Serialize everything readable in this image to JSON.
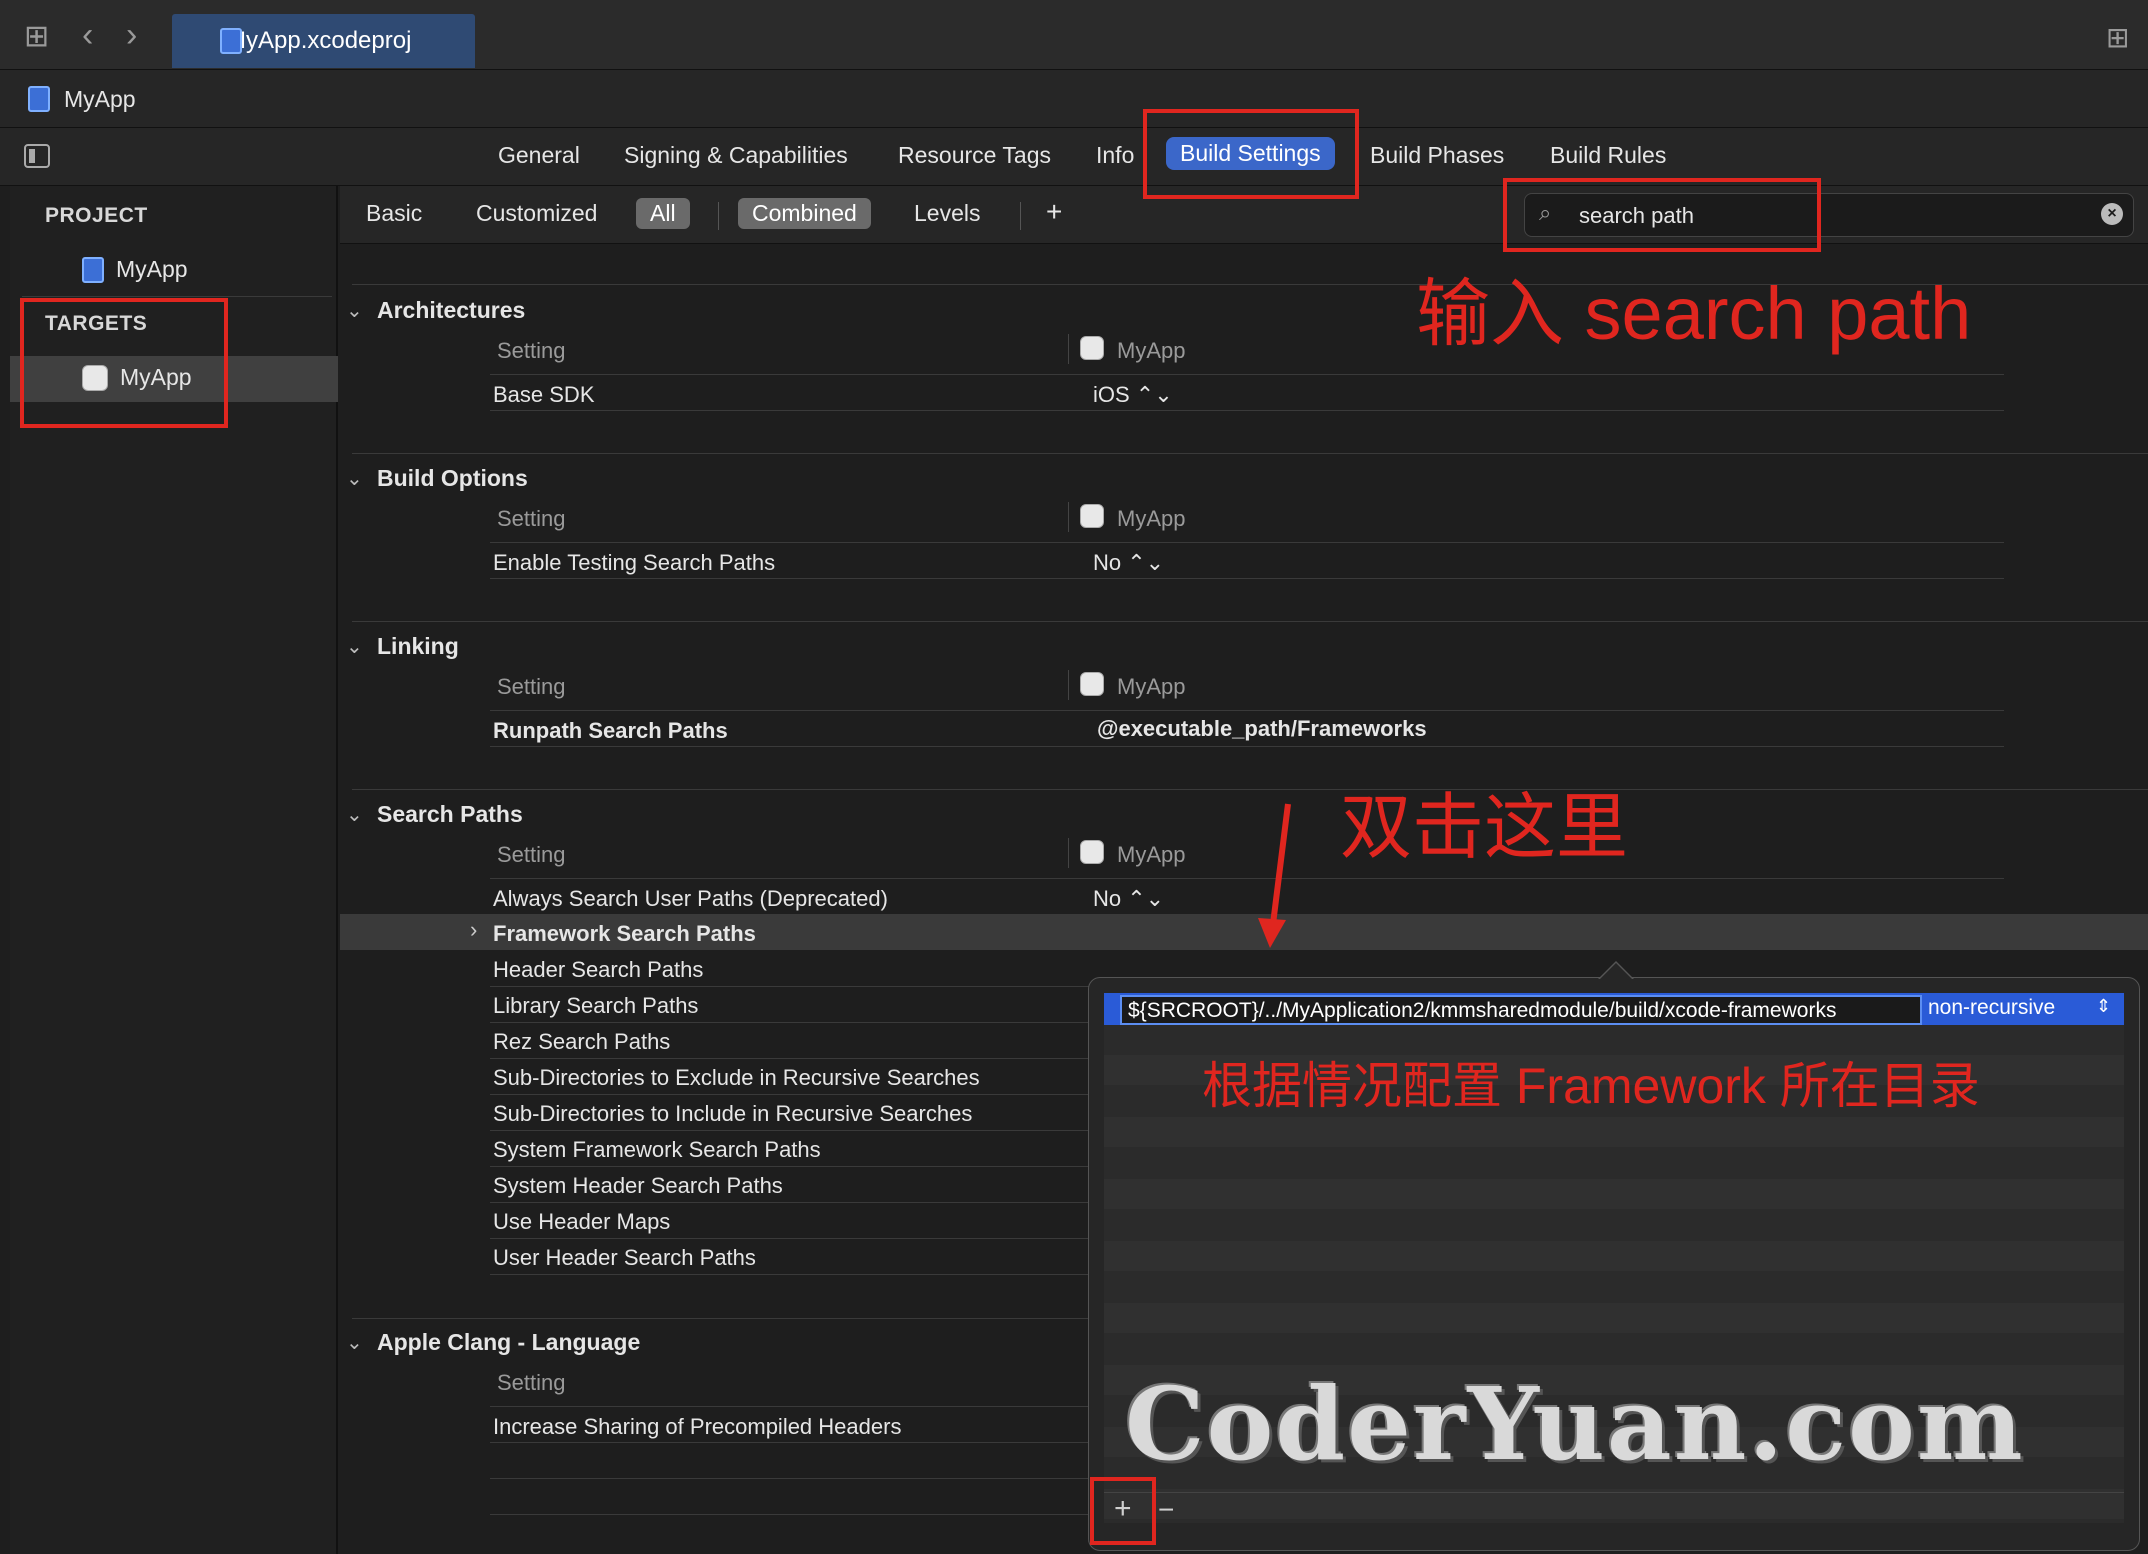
{
  "toolbar": {
    "file_tab": "MyApp.xcodeproj",
    "icons": [
      "grid-icon",
      "back-icon",
      "forward-icon",
      "add-editor-icon"
    ]
  },
  "breadcrumb": {
    "project": "MyApp"
  },
  "editor_tabs": [
    "General",
    "Signing & Capabilities",
    "Resource Tags",
    "Info",
    "Build Settings",
    "Build Phases",
    "Build Rules"
  ],
  "active_tab": "Build Settings",
  "sidebar": {
    "project_header": "PROJECT",
    "project_item": "MyApp",
    "targets_header": "TARGETS",
    "target_item": "MyApp"
  },
  "filter": {
    "basic": "Basic",
    "customized": "Customized",
    "all": "All",
    "combined": "Combined",
    "levels": "Levels",
    "add": "+",
    "search_value": "search path"
  },
  "sections": {
    "architectures": {
      "title": "Architectures",
      "setting": "Setting",
      "target": "MyApp",
      "rows": [
        {
          "label": "Base SDK",
          "value": "iOS ⌃⌄"
        }
      ]
    },
    "build_options": {
      "title": "Build Options",
      "setting": "Setting",
      "target": "MyApp",
      "rows": [
        {
          "label": "Enable Testing Search Paths",
          "value": "No ⌃⌄"
        }
      ]
    },
    "linking": {
      "title": "Linking",
      "setting": "Setting",
      "target": "MyApp",
      "rows": [
        {
          "label": "Runpath Search Paths",
          "value": "@executable_path/Frameworks"
        }
      ]
    },
    "search_paths": {
      "title": "Search Paths",
      "setting": "Setting",
      "target": "MyApp",
      "always": {
        "label": "Always Search User Paths (Deprecated)",
        "value": "No ⌃⌄"
      },
      "framework": "Framework Search Paths",
      "rows": [
        "Header Search Paths",
        "Library Search Paths",
        "Rez Search Paths",
        "Sub-Directories to Exclude in Recursive Searches",
        "Sub-Directories to Include in Recursive Searches",
        "System Framework Search Paths",
        "System Header Search Paths",
        "Use Header Maps",
        "User Header Search Paths"
      ]
    },
    "clang": {
      "title": "Apple Clang - Language",
      "setting": "Setting",
      "rows": [
        "Increase Sharing of Precompiled Headers"
      ]
    }
  },
  "popover": {
    "path_value": "${SRCROOT}/../MyApplication2/kmmsharedmodule/build/xcode-frameworks",
    "mode": "non-recursive",
    "add": "+",
    "remove": "−"
  },
  "annotations": {
    "search_hint": "输入 search path",
    "double_click_hint": "双击这里",
    "configure_hint": "根据情况配置 Framework 所在目录",
    "watermark": "CoderYuan.com"
  },
  "colors": {
    "accent": "#3b67c9",
    "annotation": "#e0261f"
  }
}
